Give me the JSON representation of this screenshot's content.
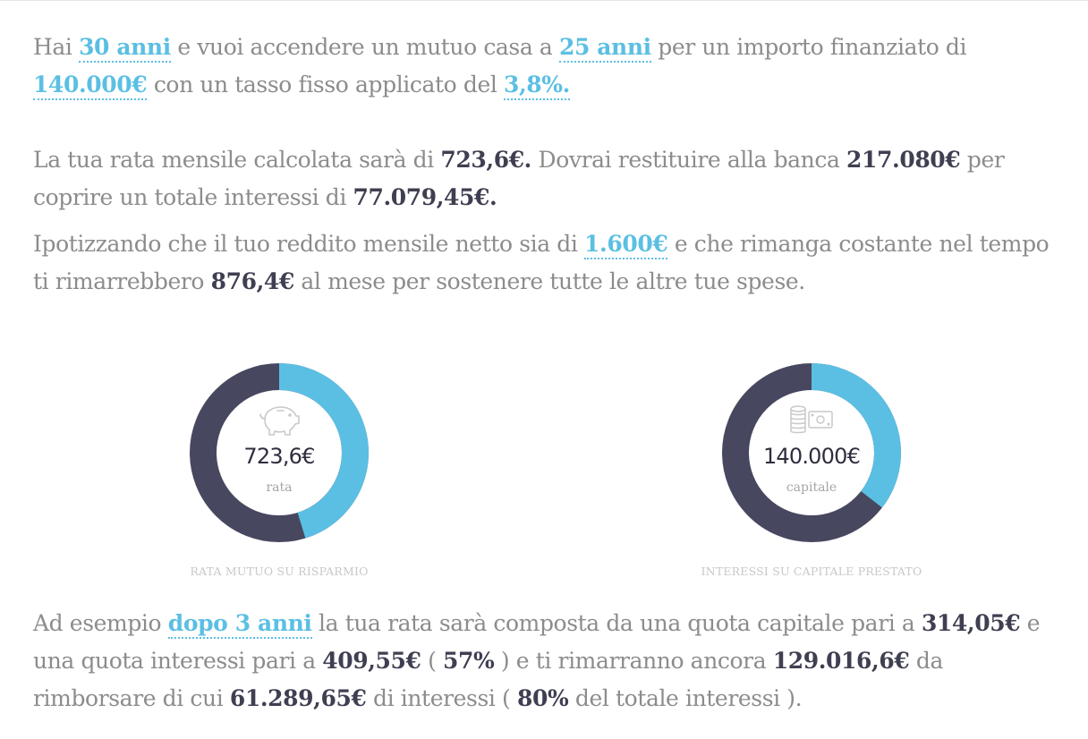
{
  "intro": {
    "t1": "Hai ",
    "age": "30 anni",
    "t2": " e vuoi accendere un mutuo casa a ",
    "duration": "25 anni",
    "t3": " per un importo finanziato di ",
    "amount": "140.000€",
    "t4": " con un tasso fisso applicato del ",
    "rate": "3,8%."
  },
  "summary": {
    "t1": "La tua rata mensile calcolata sarà di ",
    "monthly": "723,6€.",
    "t2": " Dovrai restituire alla banca ",
    "total": "217.080€",
    "t3": " per coprire un totale interessi di ",
    "interest_total": "77.079,45€."
  },
  "income": {
    "t1": "Ipotizzando che il tuo reddito mensile netto sia di ",
    "income": "1.600€",
    "t2": " e che rimanga costante nel tempo ti rimarrebbero ",
    "remaining": "876,4€",
    "t3": " al mese per sostenere tutte le altre tue spese."
  },
  "charts": {
    "left": {
      "value": "723,6€",
      "label": "rata",
      "caption": "RATA MUTUO SU RISPARMIO",
      "icon": "piggy-bank-icon",
      "fraction": 0.4523
    },
    "right": {
      "value": "140.000€",
      "label": "capitale",
      "caption": "INTERESSI SU CAPITALE PRESTATO",
      "icon": "money-coins-icon",
      "fraction": 0.3551
    }
  },
  "colors": {
    "accent": "#5bbfe3",
    "dark": "#474760",
    "text": "#8c8c8c",
    "value": "#3f3f52"
  },
  "example": {
    "t1": "Ad esempio ",
    "after": "dopo 3 anni",
    "t2": " la tua rata sarà composta da una quota capitale pari a ",
    "capital_share": "314,05€",
    "t3": " e una quota interessi pari a ",
    "interest_share": "409,55€",
    "t4": " ( ",
    "interest_pct": "57%",
    "t5": " ) e ti rimarranno ancora ",
    "remaining_debt": "129.016,6€",
    "t6": " da rimborsare di cui ",
    "remaining_interest": "61.289,65€",
    "t7": " di interessi ( ",
    "interest_ratio": "80%",
    "t8": " del totale interessi )."
  }
}
